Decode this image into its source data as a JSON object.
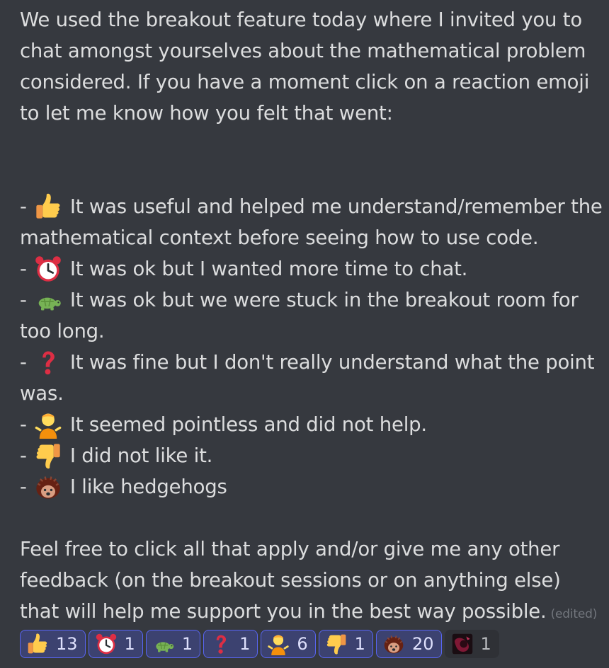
{
  "message": {
    "intro": "We used the breakout feature today where I invited you to chat amongst yourselves about the mathematical problem considered. If you have a moment click on a reaction emoji to let me know how you felt that went:",
    "dash": "-",
    "options": [
      {
        "icon": "thumbs-up-icon",
        "text": "It was useful and helped me understand/remember the mathematical context before seeing how to use code."
      },
      {
        "icon": "alarm-clock-icon",
        "text": "It was ok but I wanted more time to chat."
      },
      {
        "icon": "turtle-icon",
        "text": "It was ok but we were stuck in the breakout room for too long."
      },
      {
        "icon": "question-mark-icon",
        "text": "It was fine but I don't really understand what the point was."
      },
      {
        "icon": "person-shrugging-icon",
        "text": "It seemed pointless and did not help."
      },
      {
        "icon": "thumbs-down-icon",
        "text": "I did not like it."
      },
      {
        "icon": "hedgehog-icon",
        "text": "I like hedgehogs"
      }
    ],
    "outro": "Feel free to click all that apply and/or give me any other feedback (on the breakout sessions or on anything else) that will help me support you in the best way possible.",
    "edited": "(edited)"
  },
  "reactions": [
    {
      "icon": "thumbs-up-icon",
      "count": "13",
      "selected": true
    },
    {
      "icon": "alarm-clock-icon",
      "count": "1",
      "selected": true
    },
    {
      "icon": "turtle-icon",
      "count": "1",
      "selected": true
    },
    {
      "icon": "question-mark-icon",
      "count": "1",
      "selected": true
    },
    {
      "icon": "person-shrugging-icon",
      "count": "6",
      "selected": true
    },
    {
      "icon": "thumbs-down-icon",
      "count": "1",
      "selected": true
    },
    {
      "icon": "hedgehog-icon",
      "count": "20",
      "selected": true
    },
    {
      "icon": "custom-emoji-icon",
      "count": "1",
      "selected": false
    }
  ],
  "colors": {
    "background": "#36393f",
    "text": "#dcddde",
    "reaction_selected_bg": "#3c4270",
    "reaction_selected_border": "#5865f2",
    "edited": "#72767d"
  }
}
